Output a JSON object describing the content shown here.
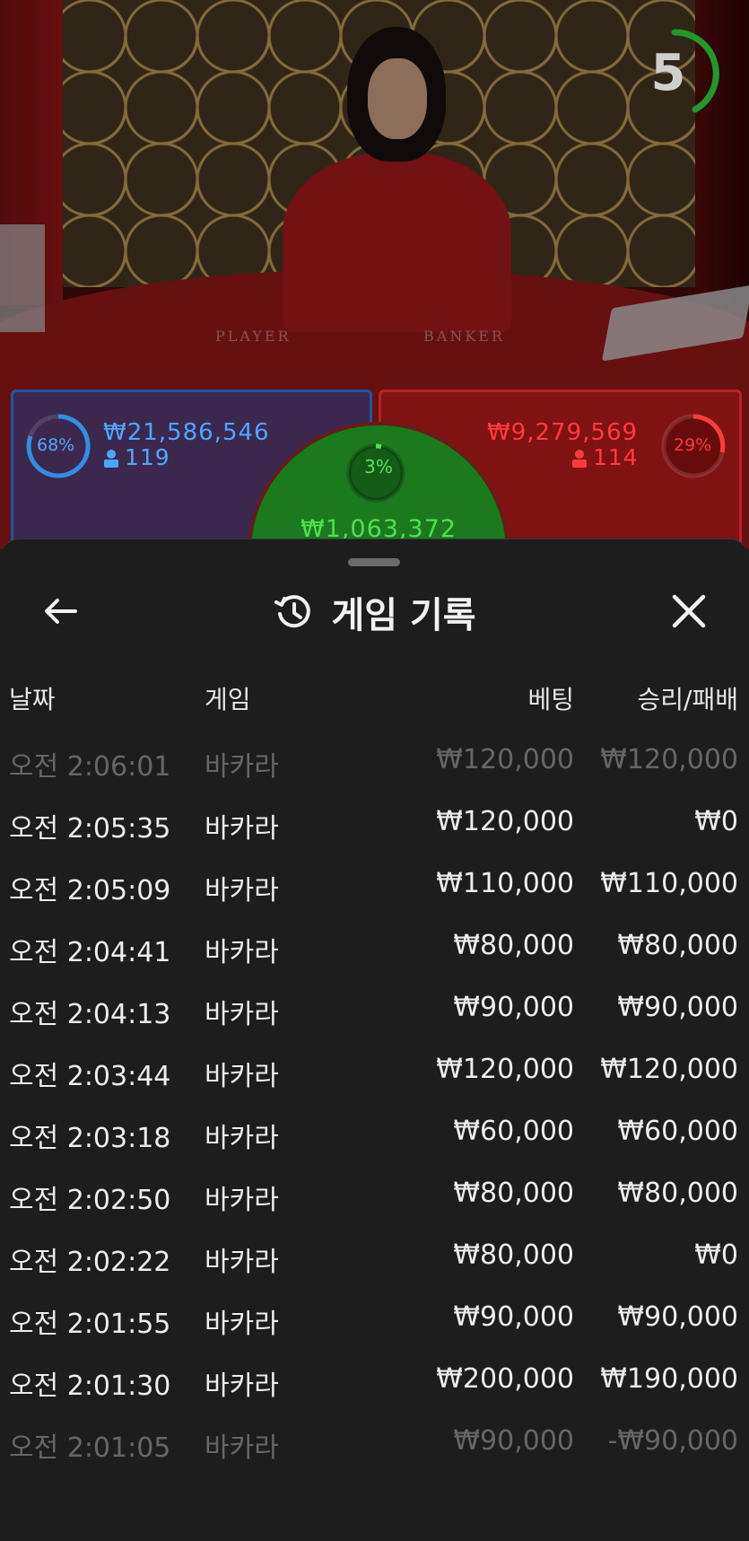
{
  "live_table": {
    "timer": "5",
    "table_labels": {
      "player": "PLAYER",
      "banker": "BANKER"
    },
    "player": {
      "percent": "68%",
      "amount": "₩21,586,546",
      "players": "119",
      "color": "#1b57a8"
    },
    "banker": {
      "percent": "29%",
      "amount": "₩9,279,569",
      "players": "114",
      "color": "#b82222"
    },
    "tie": {
      "percent": "3%",
      "amount": "₩1,063,372",
      "color": "#1b7a1e"
    }
  },
  "history": {
    "title": "게임 기록",
    "icons": {
      "back": "arrow-left-icon",
      "history": "history-icon",
      "close": "close-icon"
    },
    "columns": {
      "date": "날짜",
      "game": "게임",
      "bet": "베팅",
      "result": "승리/패배"
    },
    "rows": [
      {
        "time": "오전 2:06:01",
        "game": "바카라",
        "bet": "₩120,000",
        "result": "₩120,000"
      },
      {
        "time": "오전 2:05:35",
        "game": "바카라",
        "bet": "₩120,000",
        "result": "₩0"
      },
      {
        "time": "오전 2:05:09",
        "game": "바카라",
        "bet": "₩110,000",
        "result": "₩110,000"
      },
      {
        "time": "오전 2:04:41",
        "game": "바카라",
        "bet": "₩80,000",
        "result": "₩80,000"
      },
      {
        "time": "오전 2:04:13",
        "game": "바카라",
        "bet": "₩90,000",
        "result": "₩90,000"
      },
      {
        "time": "오전 2:03:44",
        "game": "바카라",
        "bet": "₩120,000",
        "result": "₩120,000"
      },
      {
        "time": "오전 2:03:18",
        "game": "바카라",
        "bet": "₩60,000",
        "result": "₩60,000"
      },
      {
        "time": "오전 2:02:50",
        "game": "바카라",
        "bet": "₩80,000",
        "result": "₩80,000"
      },
      {
        "time": "오전 2:02:22",
        "game": "바카라",
        "bet": "₩80,000",
        "result": "₩0"
      },
      {
        "time": "오전 2:01:55",
        "game": "바카라",
        "bet": "₩90,000",
        "result": "₩90,000"
      },
      {
        "time": "오전 2:01:30",
        "game": "바카라",
        "bet": "₩200,000",
        "result": "₩190,000"
      },
      {
        "time": "오전 2:01:05",
        "game": "바카라",
        "bet": "₩90,000",
        "result": "-₩90,000"
      }
    ]
  }
}
